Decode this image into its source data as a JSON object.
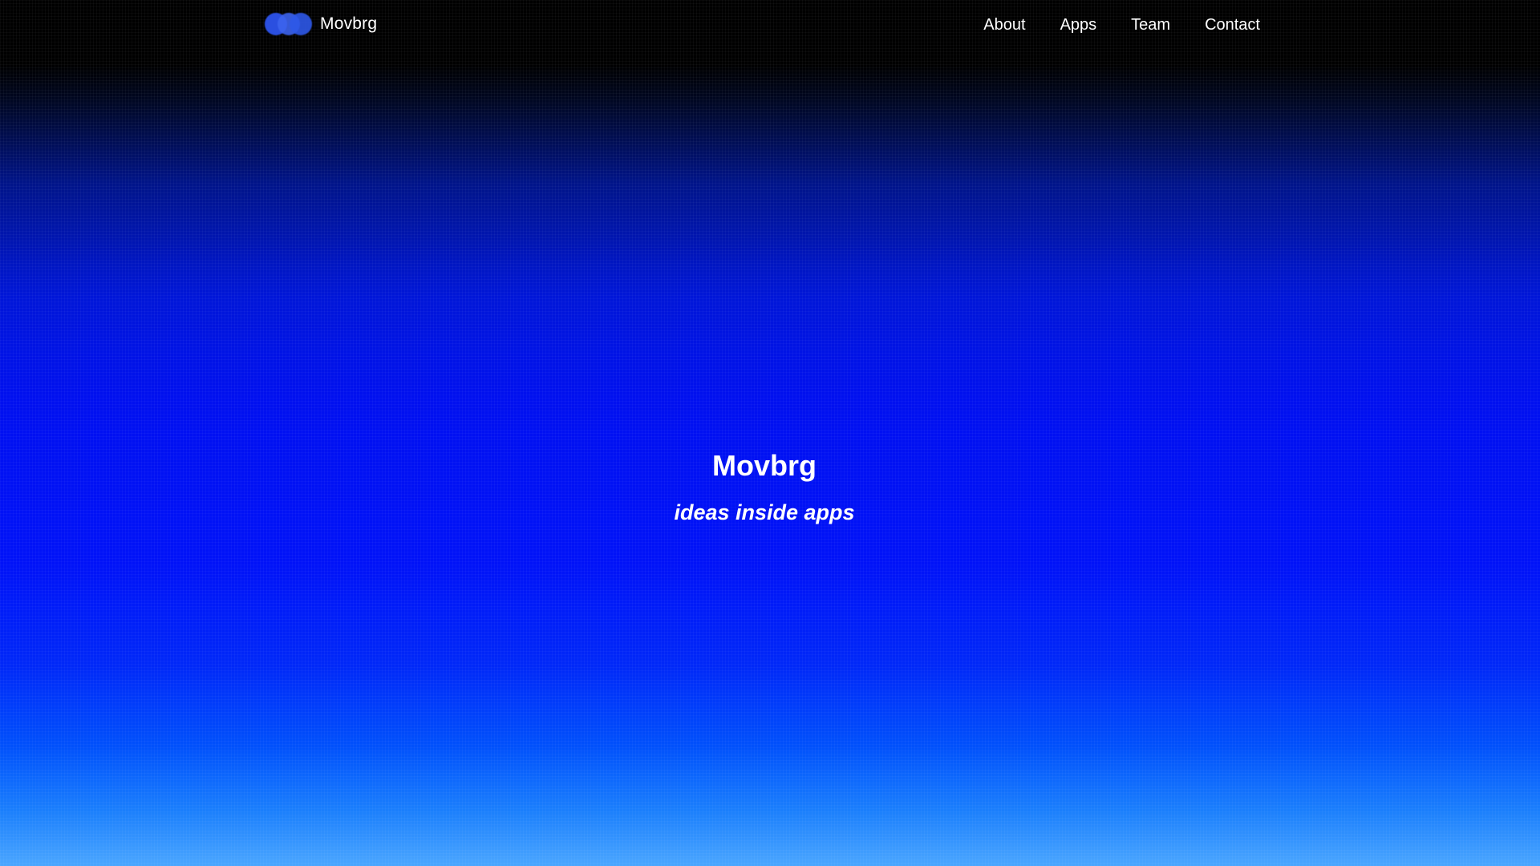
{
  "navbar": {
    "brand_name": "Movbrg",
    "logo_icon": "three-overlapping-circles-logo",
    "links": [
      {
        "label": "About"
      },
      {
        "label": "Apps"
      },
      {
        "label": "Team"
      },
      {
        "label": "Contact"
      }
    ]
  },
  "hero": {
    "title": "Movbrg",
    "tagline": "ideas inside apps"
  },
  "colors": {
    "nav_background": "#000000",
    "hero_blue": "#0012f8",
    "bottom_light_blue": "#4aa6ff",
    "logo_blue": "#2a4fe0",
    "text": "#ffffff"
  }
}
